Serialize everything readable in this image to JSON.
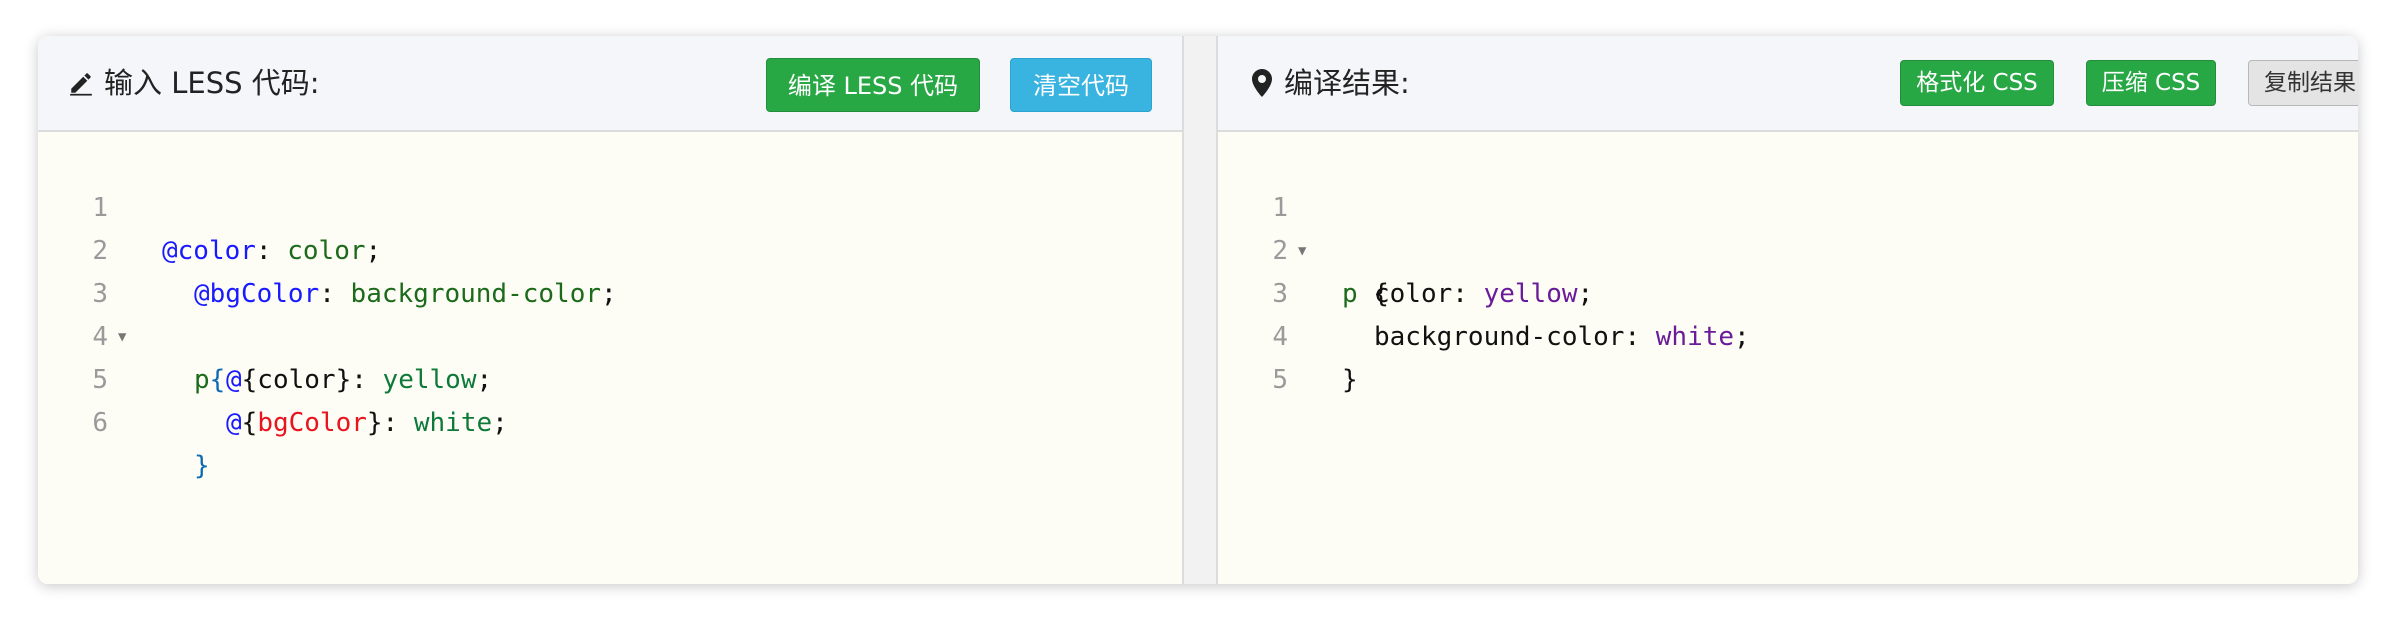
{
  "left": {
    "title": "输入 LESS 代码:",
    "buttons": {
      "compile": "编译 LESS 代码",
      "clear": "清空代码"
    },
    "lines": [
      {
        "n": "1",
        "fold": false
      },
      {
        "n": "2",
        "fold": false
      },
      {
        "n": "3",
        "fold": true
      },
      {
        "n": "4",
        "fold": false
      },
      {
        "n": "5",
        "fold": false
      },
      {
        "n": "6",
        "fold": false
      }
    ],
    "code": {
      "l1_var": "@color",
      "l1_colon": ": ",
      "l1_val": "color",
      "l1_semi": ";",
      "l2_var": "@bgColor",
      "l2_colon": ": ",
      "l2_val": "background-color",
      "l2_semi": ";",
      "l3_sel": "p",
      "l3_brace": "{",
      "l4_at": "@",
      "l4_interp": "{color}",
      "l4_colon": ": ",
      "l4_val": "yellow",
      "l4_semi": ";",
      "l5_at": "@",
      "l5_open": "{",
      "l5_name": "bgColor",
      "l5_close": "}",
      "l5_colon": ": ",
      "l5_val": "white",
      "l5_semi": ";",
      "l6_brace": "}"
    }
  },
  "right": {
    "title": "编译结果:",
    "buttons": {
      "format": "格式化 CSS",
      "minify": "压缩 CSS",
      "copy": "复制结果"
    },
    "lines": [
      {
        "n": "1",
        "fold": true
      },
      {
        "n": "2",
        "fold": false
      },
      {
        "n": "3",
        "fold": false
      },
      {
        "n": "4",
        "fold": false
      },
      {
        "n": "5",
        "fold": false
      }
    ],
    "code": {
      "l1_sel": "p",
      "l1_brace": " {",
      "l2_prop": "color",
      "l2_colon": ": ",
      "l2_val": "yellow",
      "l2_semi": ";",
      "l3_prop": "background-color",
      "l3_colon": ": ",
      "l3_val": "white",
      "l3_semi": ";",
      "l4_brace": "}"
    }
  },
  "icons": {
    "left_title_icon": "pencil-icon",
    "right_title_icon": "map-marker-icon",
    "fold_icon": "fold-triangle-icon"
  },
  "colors": {
    "green_button": "#28a745",
    "blue_button": "#39b3e0",
    "editor_background": "#fdfdf6"
  }
}
